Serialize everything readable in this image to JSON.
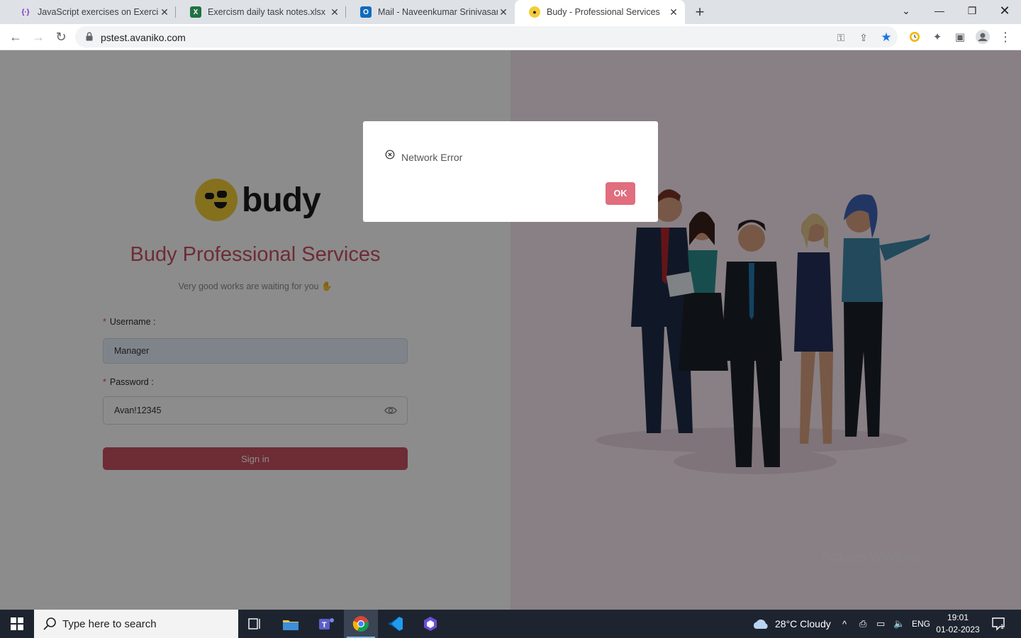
{
  "browser": {
    "tabs": [
      {
        "title": "JavaScript exercises on Exercism",
        "icon": "exercism-icon"
      },
      {
        "title": "Exercism daily task notes.xlsx",
        "icon": "excel-icon"
      },
      {
        "title": "Mail - Naveenkumar Srinivasan -",
        "icon": "outlook-icon"
      },
      {
        "title": "Budy - Professional Services",
        "icon": "budy-favicon-icon",
        "active": true
      }
    ],
    "url": "pstest.avaniko.com"
  },
  "login": {
    "logo_text": "budy",
    "title": "Budy Professional Services",
    "subtitle": "Very good works are waiting for you",
    "username_label": "Username :",
    "username_value": "Manager",
    "password_label": "Password :",
    "password_value": "Avan!12345",
    "signin_label": "Sign in"
  },
  "right_panel": {
    "watermark": "Activate Windows"
  },
  "modal": {
    "message": "Network Error",
    "ok_label": "OK"
  },
  "taskbar": {
    "search_placeholder": "Type here to search",
    "weather": "28°C  Cloudy",
    "lang": "ENG",
    "time": "19:01",
    "date": "01-02-2023",
    "notification_count": "1"
  },
  "colors": {
    "brand": "#c85061",
    "logo_yellow": "#f2cd38",
    "ok_button": "#e06e7e",
    "right_bg": "#f8eaf0"
  }
}
